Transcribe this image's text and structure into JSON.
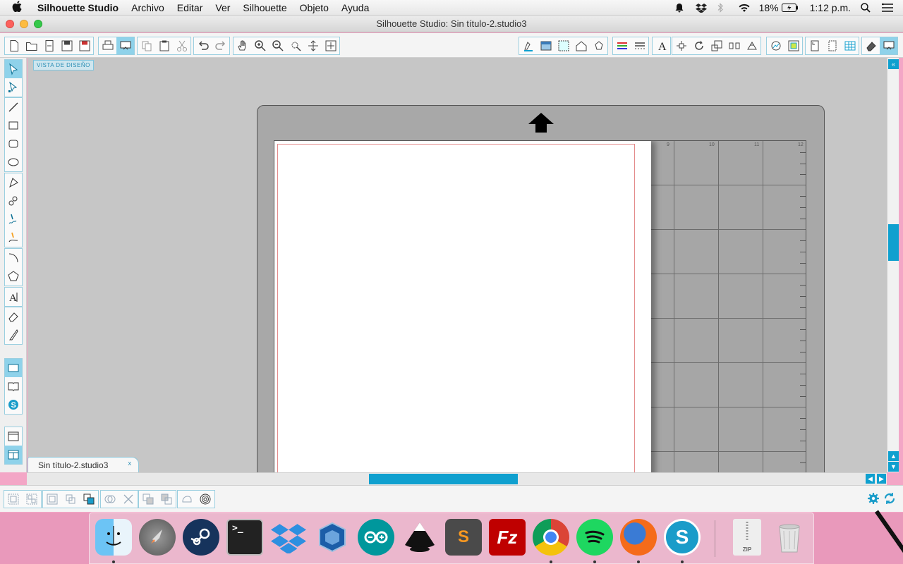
{
  "menubar": {
    "app_name": "Silhouette Studio",
    "items": [
      "Archivo",
      "Editar",
      "Ver",
      "Silhouette",
      "Objeto",
      "Ayuda"
    ],
    "battery": "18%",
    "time": "1:12 p.m."
  },
  "window": {
    "title": "Silhouette Studio: Sin título-2.studio3"
  },
  "canvas": {
    "view_label": "VISTA DE DISEÑO",
    "ruler_numbers": [
      "9",
      "10",
      "11",
      "12"
    ]
  },
  "document_tab": {
    "label": "Sin título-2.studio3",
    "close": "x"
  },
  "dock": {
    "apps": [
      "Finder",
      "Launchpad",
      "Steam",
      "Terminal",
      "Dropbox",
      "VirtualBox",
      "Arduino",
      "Inkscape",
      "Sublime Text",
      "FileZilla",
      "Chrome",
      "Spotify",
      "Firefox",
      "Silhouette Studio"
    ],
    "zip_label": "ZIP"
  },
  "colors": {
    "accent": "#0fa0cf",
    "accent_light": "#8fd2ea",
    "canvas_bg": "#c6c6c6",
    "mat": "#a8a8a8",
    "desktop": "#f3a6c6"
  }
}
